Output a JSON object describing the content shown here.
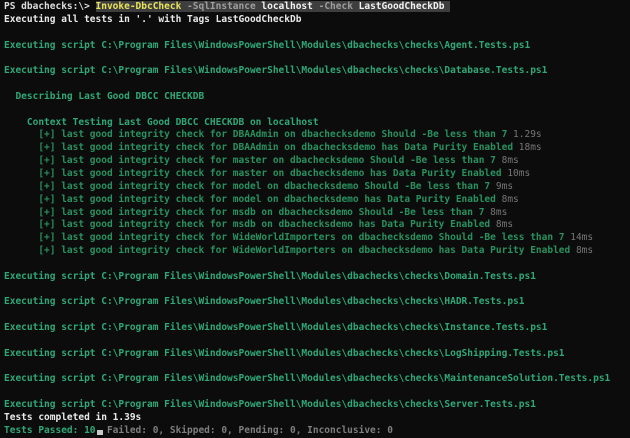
{
  "terminal": {
    "colors": {
      "background": "#0C0C0C",
      "command_yellow": "#E8E35A",
      "selection_background": "#3E3E3E",
      "parameter_gray": "#9E9E9E",
      "bright_green": "#2FA878",
      "test_green": "#28915F",
      "duration_gray": "#767676",
      "white": "#EAEAEA"
    },
    "prompt": "PS dbachecks:\\> ",
    "command": "Invoke-DbcCheck -SqlInstance localhost -Check LastGoodCheckDb",
    "lines": [
      {
        "segments": [
          {
            "style": "prompt",
            "name": "prompt",
            "text": "PS dbachecks:\\> "
          },
          {
            "style": "hl-cmd",
            "name": "command-name",
            "text": "Invoke-DbcCheck"
          },
          {
            "style": "hl-param",
            "name": "command-parameter",
            "text": " -SqlInstance "
          },
          {
            "style": "hl-arg",
            "name": "command-argument",
            "text": "localhost"
          },
          {
            "style": "hl-param",
            "name": "command-parameter",
            "text": " -Check "
          },
          {
            "style": "hl-arg",
            "name": "command-argument",
            "text": "LastGoodCheckDb "
          }
        ]
      },
      {
        "segments": [
          {
            "style": "bold",
            "name": "output-text",
            "text": "Executing all tests in '.' with Tags LastGoodCheckDb"
          }
        ]
      },
      {
        "segments": []
      },
      {
        "segments": [
          {
            "style": "green",
            "name": "executing-script-line",
            "text": "Executing script C:\\Program Files\\WindowsPowerShell\\Modules\\dbachecks\\checks\\Agent.Tests.ps1"
          }
        ]
      },
      {
        "segments": []
      },
      {
        "segments": [
          {
            "style": "green",
            "name": "executing-script-line",
            "text": "Executing script C:\\Program Files\\WindowsPowerShell\\Modules\\dbachecks\\checks\\Database.Tests.ps1"
          }
        ]
      },
      {
        "segments": []
      },
      {
        "segments": [
          {
            "style": "green",
            "name": "describe-heading",
            "text": "  Describing Last Good DBCC CHECKDB"
          }
        ]
      },
      {
        "segments": []
      },
      {
        "segments": [
          {
            "style": "green",
            "name": "context-heading",
            "text": "    Context Testing Last Good DBCC CHECKDB on localhost"
          }
        ]
      },
      {
        "segments": [
          {
            "style": "testgreen",
            "name": "test-result",
            "text": "      [+] last good integrity check for DBAAdmin on dbachecksdemo Should -Be less than 7 "
          },
          {
            "style": "time",
            "name": "test-duration",
            "text": "1.29s"
          }
        ]
      },
      {
        "segments": [
          {
            "style": "testgreen",
            "name": "test-result",
            "text": "      [+] last good integrity check for DBAAdmin on dbachecksdemo has Data Purity Enabled "
          },
          {
            "style": "time",
            "name": "test-duration",
            "text": "18ms"
          }
        ]
      },
      {
        "segments": [
          {
            "style": "testgreen",
            "name": "test-result",
            "text": "      [+] last good integrity check for master on dbachecksdemo Should -Be less than 7 "
          },
          {
            "style": "time",
            "name": "test-duration",
            "text": "8ms"
          }
        ]
      },
      {
        "segments": [
          {
            "style": "testgreen",
            "name": "test-result",
            "text": "      [+] last good integrity check for master on dbachecksdemo has Data Purity Enabled "
          },
          {
            "style": "time",
            "name": "test-duration",
            "text": "10ms"
          }
        ]
      },
      {
        "segments": [
          {
            "style": "testgreen",
            "name": "test-result",
            "text": "      [+] last good integrity check for model on dbachecksdemo Should -Be less than 7 "
          },
          {
            "style": "time",
            "name": "test-duration",
            "text": "9ms"
          }
        ]
      },
      {
        "segments": [
          {
            "style": "testgreen",
            "name": "test-result",
            "text": "      [+] last good integrity check for model on dbachecksdemo has Data Purity Enabled "
          },
          {
            "style": "time",
            "name": "test-duration",
            "text": "8ms"
          }
        ]
      },
      {
        "segments": [
          {
            "style": "testgreen",
            "name": "test-result",
            "text": "      [+] last good integrity check for msdb on dbachecksdemo Should -Be less than 7 "
          },
          {
            "style": "time",
            "name": "test-duration",
            "text": "8ms"
          }
        ]
      },
      {
        "segments": [
          {
            "style": "testgreen",
            "name": "test-result",
            "text": "      [+] last good integrity check for msdb on dbachecksdemo has Data Purity Enabled "
          },
          {
            "style": "time",
            "name": "test-duration",
            "text": "8ms"
          }
        ]
      },
      {
        "segments": [
          {
            "style": "testgreen",
            "name": "test-result",
            "text": "      [+] last good integrity check for WideWorldImporters on dbachecksdemo Should -Be less than 7 "
          },
          {
            "style": "time",
            "name": "test-duration",
            "text": "14ms"
          }
        ]
      },
      {
        "segments": [
          {
            "style": "testgreen",
            "name": "test-result",
            "text": "      [+] last good integrity check for WideWorldImporters on dbachecksdemo has Data Purity Enabled "
          },
          {
            "style": "time",
            "name": "test-duration",
            "text": "8ms"
          }
        ]
      },
      {
        "segments": []
      },
      {
        "segments": [
          {
            "style": "green",
            "name": "executing-script-line",
            "text": "Executing script C:\\Program Files\\WindowsPowerShell\\Modules\\dbachecks\\checks\\Domain.Tests.ps1"
          }
        ]
      },
      {
        "segments": []
      },
      {
        "segments": [
          {
            "style": "green",
            "name": "executing-script-line",
            "text": "Executing script C:\\Program Files\\WindowsPowerShell\\Modules\\dbachecks\\checks\\HADR.Tests.ps1"
          }
        ]
      },
      {
        "segments": []
      },
      {
        "segments": [
          {
            "style": "green",
            "name": "executing-script-line",
            "text": "Executing script C:\\Program Files\\WindowsPowerShell\\Modules\\dbachecks\\checks\\Instance.Tests.ps1"
          }
        ]
      },
      {
        "segments": []
      },
      {
        "segments": [
          {
            "style": "green",
            "name": "executing-script-line",
            "text": "Executing script C:\\Program Files\\WindowsPowerShell\\Modules\\dbachecks\\checks\\LogShipping.Tests.ps1"
          }
        ]
      },
      {
        "segments": []
      },
      {
        "segments": [
          {
            "style": "green",
            "name": "executing-script-line",
            "text": "Executing script C:\\Program Files\\WindowsPowerShell\\Modules\\dbachecks\\checks\\MaintenanceSolution.Tests.ps1"
          }
        ]
      },
      {
        "segments": []
      },
      {
        "segments": [
          {
            "style": "green",
            "name": "executing-script-line",
            "text": "Executing script C:\\Program Files\\WindowsPowerShell\\Modules\\dbachecks\\checks\\Server.Tests.ps1"
          }
        ]
      },
      {
        "segments": [
          {
            "style": "bold",
            "name": "tests-completed-text",
            "text": "Tests completed in 1.39s"
          }
        ]
      },
      {
        "segments": [
          {
            "style": "green",
            "name": "tests-passed-count",
            "text": "Tests Passed: 10, "
          },
          {
            "style": "gray",
            "name": "summary-counts",
            "text": "Failed: 0, Skipped: 0, Pending: 0, Inconclusive: 0"
          }
        ]
      }
    ]
  }
}
